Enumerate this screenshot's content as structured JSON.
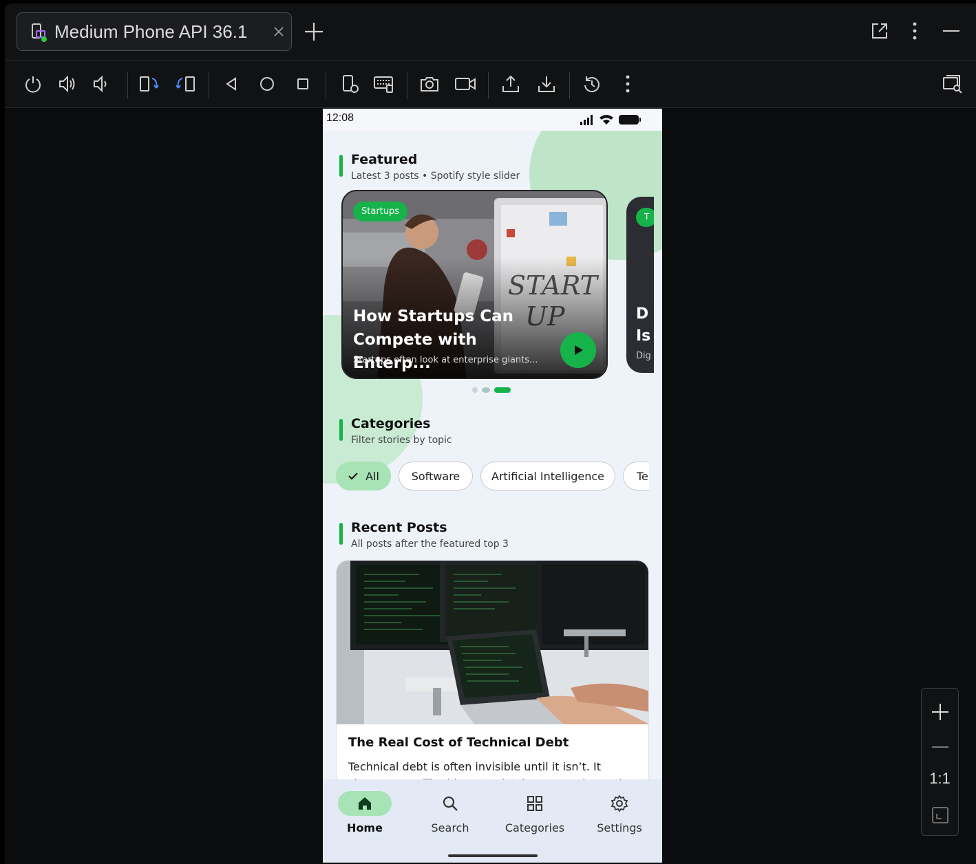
{
  "window": {
    "tab_title": "Medium Phone API 36.1",
    "tab_close": "×"
  },
  "toolbar": {
    "icons": [
      "power-icon",
      "volume-up-icon",
      "volume-down-icon",
      "rotate-left-icon",
      "rotate-right-icon",
      "back-icon",
      "home-icon",
      "overview-icon",
      "device-settings-icon",
      "keyboard-icon",
      "camera-icon",
      "record-icon",
      "export-icon",
      "import-icon",
      "reset-icon",
      "more-icon",
      "inspect-icon"
    ]
  },
  "phone": {
    "time": "12:08",
    "featured": {
      "title": "Featured",
      "subtitle": "Latest 3 posts • Spotify style slider",
      "card": {
        "tag": "Startups",
        "title": "How Startups Can Compete with Enterp...",
        "excerpt": "Startups often look at enterprise giants..."
      },
      "next_card": {
        "tag": "T",
        "title_line1": "D",
        "title_line2": "Is",
        "excerpt": "Dig"
      },
      "active_slide": 3,
      "slide_count": 3
    },
    "categories": {
      "title": "Categories",
      "subtitle": "Filter stories by topic",
      "chips": [
        "All",
        "Software",
        "Artificial Intelligence",
        "Te"
      ],
      "selected": "All"
    },
    "recent": {
      "title": "Recent Posts",
      "subtitle": "All posts after the featured top 3",
      "post": {
        "title": "The Real Cost of Technical Debt",
        "body": "Technical debt is often invisible until it isn’t. It shows up as. The biggest mistake companies make"
      }
    },
    "nav": {
      "items": [
        "Home",
        "Search",
        "Categories",
        "Settings"
      ],
      "active": "Home"
    }
  },
  "zoom": {
    "ratio_label": "1:1"
  },
  "colors": {
    "accent": "#16b34a",
    "chip_selected": "#a7e3b5",
    "bg": "#0b0c0e"
  }
}
